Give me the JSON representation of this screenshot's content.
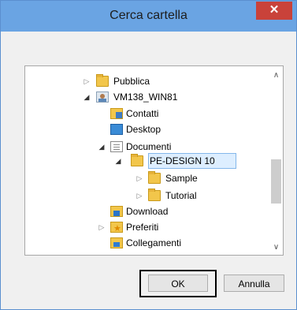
{
  "dialog": {
    "title": "Cerca cartella",
    "close_label": "✕"
  },
  "tree": {
    "items": [
      {
        "label": "Pubblica",
        "icon": "folder-icon",
        "expander": "collapsed"
      },
      {
        "label": "VM138_WIN81",
        "icon": "user-folder-icon",
        "expander": "expanded"
      },
      {
        "label": "Contatti",
        "icon": "contacts-icon",
        "expander": "none"
      },
      {
        "label": "Desktop",
        "icon": "desktop-icon",
        "expander": "none"
      },
      {
        "label": "Documenti",
        "icon": "documents-icon",
        "expander": "expanded"
      },
      {
        "label": "PE-DESIGN 10",
        "icon": "folder-icon",
        "expander": "expanded",
        "selected": true
      },
      {
        "label": "Sample",
        "icon": "folder-icon",
        "expander": "collapsed"
      },
      {
        "label": "Tutorial",
        "icon": "folder-icon",
        "expander": "collapsed"
      },
      {
        "label": "Download",
        "icon": "download-icon",
        "expander": "none"
      },
      {
        "label": "Preferiti",
        "icon": "favorites-icon",
        "expander": "collapsed"
      },
      {
        "label": "Collegamenti",
        "icon": "links-icon",
        "expander": "none"
      }
    ]
  },
  "buttons": {
    "ok": "OK",
    "cancel": "Annulla"
  },
  "colors": {
    "titlebar": "#6aa4e3",
    "close": "#c9423a",
    "selection": "#ddeeff"
  }
}
